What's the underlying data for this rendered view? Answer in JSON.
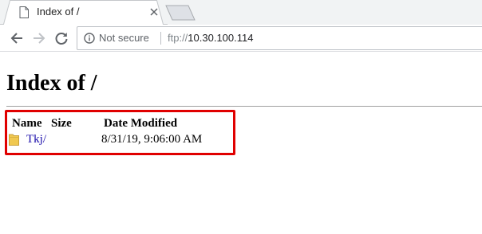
{
  "browser": {
    "tab": {
      "title": "Index of /"
    },
    "address_bar": {
      "security_label": "Not secure",
      "url_scheme": "ftp://",
      "url_host": "10.30.100.114"
    }
  },
  "page": {
    "heading": "Index of /",
    "table": {
      "columns": [
        "Name",
        "Size",
        "Date Modified"
      ],
      "rows": [
        {
          "name": "Tkj/",
          "size": "",
          "date_modified": "8/31/19, 9:06:00 AM",
          "icon": "folder-icon"
        }
      ]
    }
  },
  "colors": {
    "highlight": "#e00000",
    "link": "#1a0dab"
  }
}
